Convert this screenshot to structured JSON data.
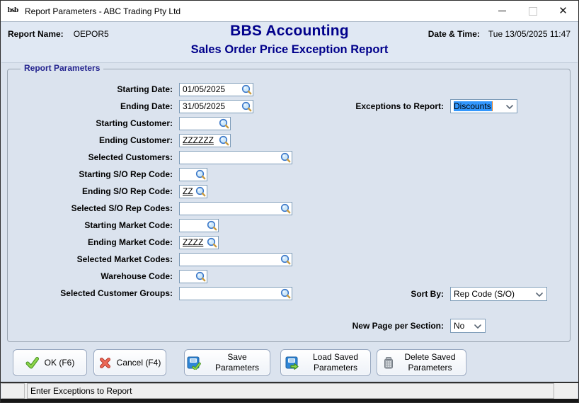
{
  "window": {
    "logo_text": "bsb",
    "title": "Report Parameters - ABC Trading Pty Ltd"
  },
  "header": {
    "report_name_label": "Report Name:",
    "report_name_value": "OEPOR5",
    "app_title": "BBS Accounting",
    "report_title": "Sales Order Price Exception Report",
    "datetime_label": "Date & Time:",
    "datetime_value": "Tue 13/05/2025 11:47"
  },
  "parameters": {
    "group_label": "Report Parameters",
    "fields": [
      {
        "label": "Starting Date:",
        "value": "01/05/2025"
      },
      {
        "label": "Ending Date:",
        "value": "31/05/2025"
      },
      {
        "label": "Starting Customer:",
        "value": ""
      },
      {
        "label": "Ending Customer:",
        "value": "ZZZZZZ"
      },
      {
        "label": "Selected Customers:",
        "value": ""
      },
      {
        "label": "Starting S/O Rep Code:",
        "value": ""
      },
      {
        "label": "Ending S/O Rep Code:",
        "value": "ZZ"
      },
      {
        "label": "Selected S/O Rep Codes:",
        "value": ""
      },
      {
        "label": "Starting Market Code:",
        "value": ""
      },
      {
        "label": "Ending Market Code:",
        "value": "ZZZZ"
      },
      {
        "label": "Selected Market Codes:",
        "value": ""
      },
      {
        "label": "Warehouse Code:",
        "value": ""
      },
      {
        "label": "Selected Customer Groups:",
        "value": ""
      }
    ],
    "exceptions": {
      "label": "Exceptions to Report:",
      "value": "Discounts"
    },
    "sort_by": {
      "label": "Sort By:",
      "value": "Rep Code (S/O)"
    },
    "new_page": {
      "label": "New Page per Section:",
      "value": "No"
    }
  },
  "buttons": {
    "ok": "OK (F6)",
    "cancel": "Cancel (F4)",
    "save": "Save Parameters",
    "load": "Load Saved Parameters",
    "delete": "Delete Saved Parameters"
  },
  "status_bar": {
    "message": "Enter Exceptions to Report"
  },
  "icons": {
    "lookup_icon": "magnifier",
    "dropdown_icon": "chevron-down",
    "ok_icon": "green-check",
    "cancel_icon": "red-cross",
    "save_icon": "disk-with-check",
    "load_icon": "disk-with-arrow",
    "delete_icon": "trash-bin",
    "minimize_icon": "minimize-bar",
    "maximize_icon": "maximize-box",
    "close_icon": "close-x"
  },
  "colors": {
    "accent_navy": "#00008b",
    "selection_blue": "#3297fd",
    "ok_green": "#5cb82e",
    "cancel_red": "#e0473a",
    "header_band": "#e0e8f3",
    "main_background": "#dbe3ee"
  }
}
